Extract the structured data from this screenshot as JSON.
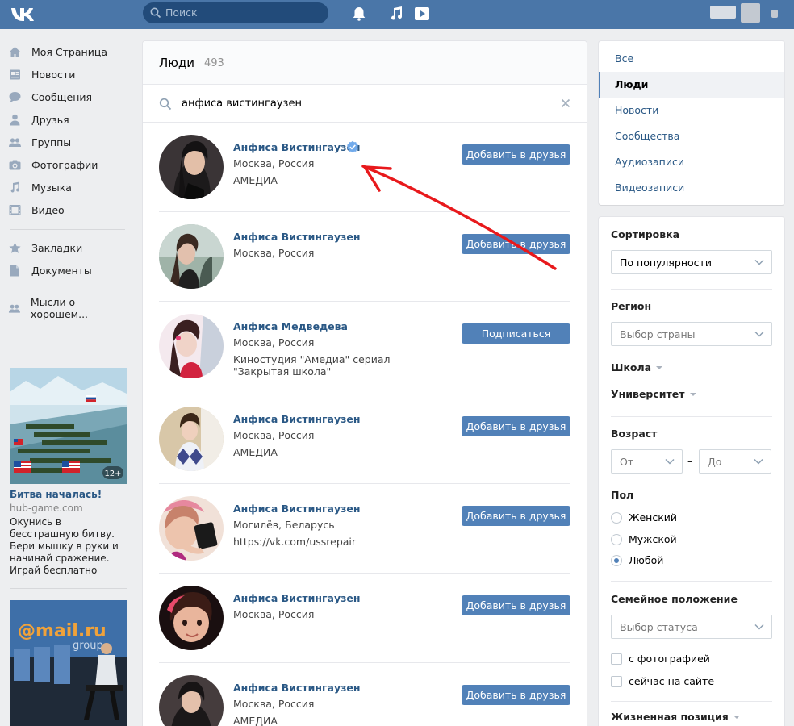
{
  "header": {
    "search_placeholder": "Поиск"
  },
  "left_menu": {
    "items": [
      {
        "label": "Моя Страница",
        "icon": "home-icon"
      },
      {
        "label": "Новости",
        "icon": "news-icon"
      },
      {
        "label": "Сообщения",
        "icon": "messages-icon"
      },
      {
        "label": "Друзья",
        "icon": "friend-icon"
      },
      {
        "label": "Группы",
        "icon": "groups-icon"
      },
      {
        "label": "Фотографии",
        "icon": "camera-icon"
      },
      {
        "label": "Музыка",
        "icon": "music-icon"
      },
      {
        "label": "Видео",
        "icon": "video-icon"
      },
      {
        "label": "Закладки",
        "icon": "star-icon"
      },
      {
        "label": "Документы",
        "icon": "document-icon"
      },
      {
        "label": "Мысли о хорошем...",
        "icon": "friends-icon"
      }
    ]
  },
  "ads": {
    "game": {
      "badge": "12+",
      "title": "Битва началась!",
      "domain": "hub-game.com",
      "description": "Окунись в бесстрашную битву. Бери мышку в руки и начинай сражение. Играй бесплатно"
    },
    "mail_banner": {
      "logo_text": "@mail.ru",
      "sub_text": "group"
    }
  },
  "people": {
    "title": "Люди",
    "count": "493",
    "query": "анфиса вистингаузен",
    "results": [
      {
        "name": "Анфиса Вистингаузен",
        "verified": true,
        "lines": [
          "Москва, Россия",
          "АМЕДИА"
        ],
        "action": "Добавить в друзья"
      },
      {
        "name": "Анфиса Вистингаузен",
        "verified": false,
        "lines": [
          "Москва, Россия"
        ],
        "action": "Добавить в друзья"
      },
      {
        "name": "Анфиса Медведева",
        "verified": false,
        "lines": [
          "Москва, Россия",
          "Киностудия \"Амедиа\" сериал \"Закрытая школа\""
        ],
        "action": "Подписаться"
      },
      {
        "name": "Анфиса Вистингаузен",
        "verified": false,
        "lines": [
          "Москва, Россия",
          "АМЕДИА"
        ],
        "action": "Добавить в друзья"
      },
      {
        "name": "Анфиса Вистингаузен",
        "verified": false,
        "lines": [
          "Могилёв, Беларусь",
          "https://vk.com/ussrepair"
        ],
        "action": "Добавить в друзья"
      },
      {
        "name": "Анфиса Вистингаузен",
        "verified": false,
        "lines": [
          "Москва, Россия"
        ],
        "action": "Добавить в друзья"
      },
      {
        "name": "Анфиса Вистингаузен",
        "verified": false,
        "lines": [
          "Москва, Россия",
          "АМЕДИА"
        ],
        "action": "Добавить в друзья"
      }
    ]
  },
  "section_nav": {
    "items": [
      "Все",
      "Люди",
      "Новости",
      "Сообщества",
      "Аудиозаписи",
      "Видеозаписи"
    ],
    "active": "Люди"
  },
  "filters": {
    "sort_label": "Сортировка",
    "sort_value": "По популярности",
    "region_label": "Регион",
    "region_placeholder": "Выбор страны",
    "school_label": "Школа",
    "university_label": "Университет",
    "age_label": "Возраст",
    "age_from": "От",
    "age_dash": "–",
    "age_to": "До",
    "gender_label": "Пол",
    "gender_options": [
      "Женский",
      "Мужской",
      "Любой"
    ],
    "gender_selected": "Любой",
    "family_label": "Семейное положение",
    "family_placeholder": "Выбор статуса",
    "with_photo": "с фотографией",
    "online_now": "сейчас на сайте",
    "life_position_label": "Жизненная позиция"
  },
  "colors": {
    "header_bg": "#4a76a8",
    "link": "#2a5885",
    "button": "#5181b8",
    "annotation_arrow": "#e8191c"
  }
}
